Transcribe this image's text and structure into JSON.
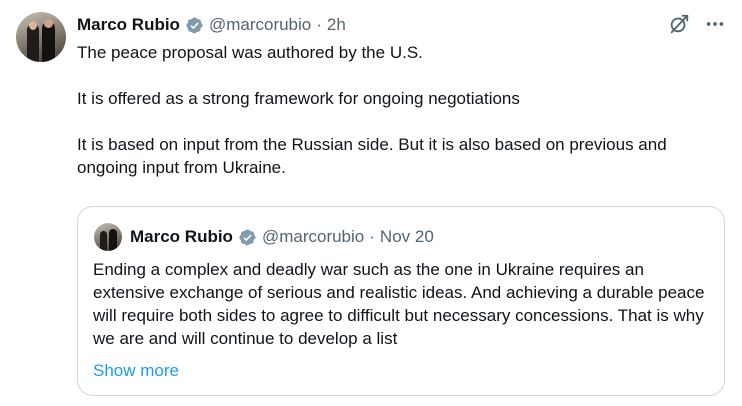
{
  "post": {
    "author_name": "Marco Rubio",
    "handle": "@marcorubio",
    "separator": "·",
    "time": "2h",
    "paragraphs": [
      "The peace proposal was authored by the U.S.",
      "It is offered as a strong framework for ongoing negotiations",
      "It is based on input from the Russian side. But it is also based on previous and ongoing input from Ukraine."
    ]
  },
  "quote": {
    "author_name": "Marco Rubio",
    "handle": "@marcorubio",
    "separator": "·",
    "date": "Nov 20",
    "text": "Ending a complex and deadly war such as the one in Ukraine requires an extensive exchange of serious and realistic ideas. And achieving a durable peace will require both sides to agree to difficult but necessary concessions. That is why we are and will continue to develop a list",
    "show_more_label": "Show more"
  },
  "colors": {
    "text": "#0f1419",
    "secondary": "#536471",
    "accent": "#1d9bf0",
    "border": "#cfd9de",
    "verified_badge": "#829aab"
  },
  "icons": {
    "grok": "grok-icon",
    "more": "more-icon",
    "verified": "verified-badge-icon"
  }
}
